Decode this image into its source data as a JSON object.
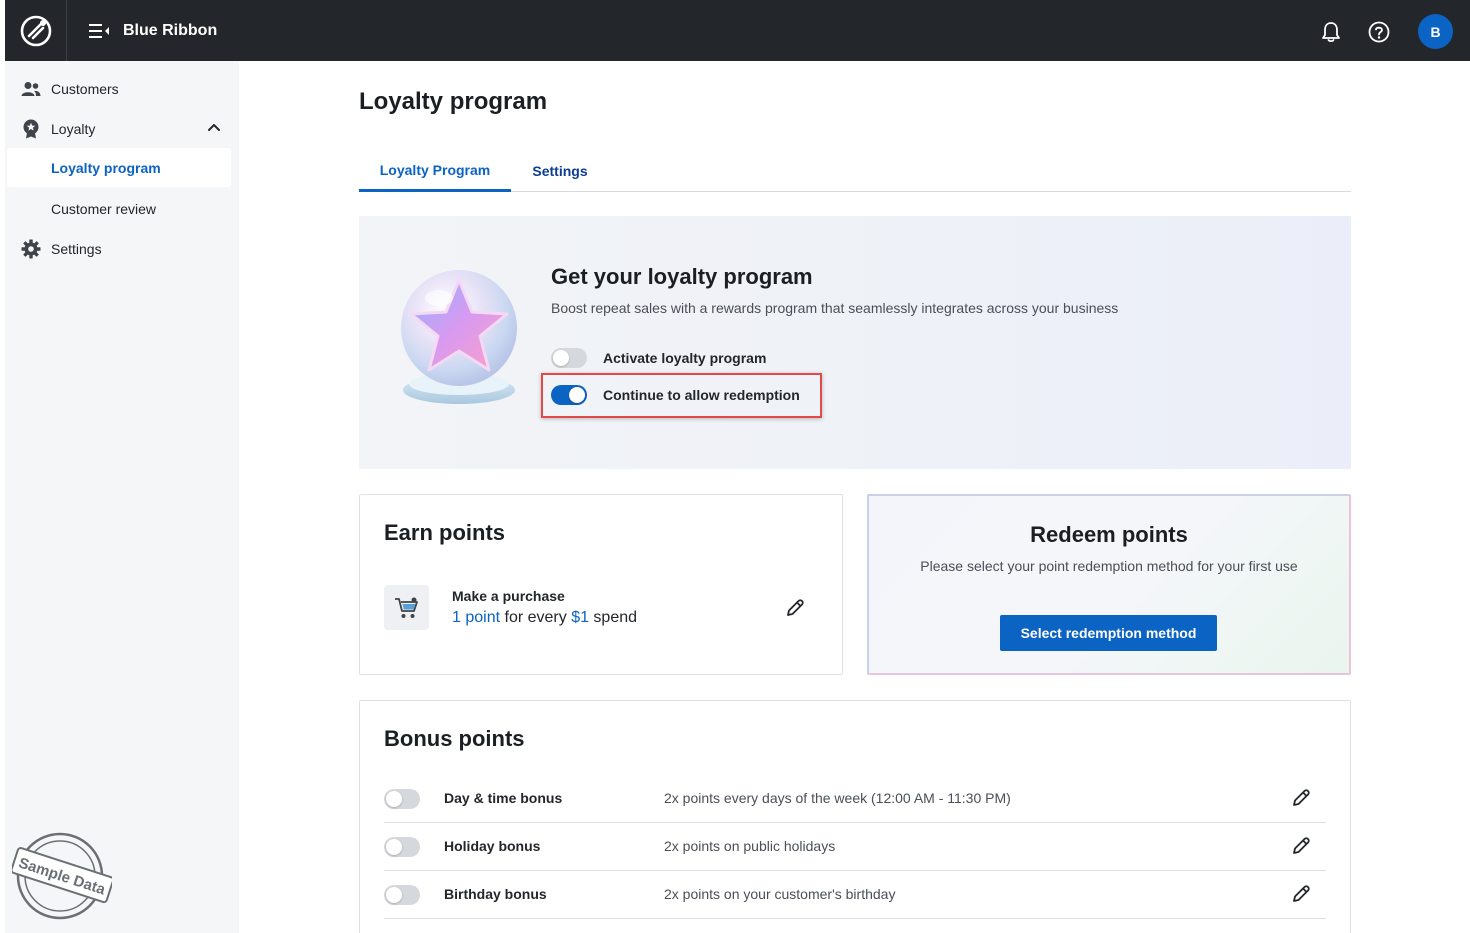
{
  "header": {
    "brand": "Blue Ribbon",
    "avatar_initial": "B",
    "icons": [
      "app-logo-icon",
      "menu-collapse-icon",
      "bell-icon",
      "help-icon"
    ]
  },
  "sidebar": {
    "items": [
      {
        "label": "Customers",
        "icon": "people-icon"
      },
      {
        "label": "Loyalty",
        "icon": "badge-icon",
        "expanded": true
      },
      {
        "label": "Loyalty program",
        "active": true
      },
      {
        "label": "Customer review"
      },
      {
        "label": "Settings",
        "icon": "gear-icon"
      }
    ],
    "stamp_text": "Sample Data"
  },
  "main": {
    "title": "Loyalty program",
    "tabs": [
      {
        "label": "Loyalty Program",
        "active": true
      },
      {
        "label": "Settings",
        "active": false
      }
    ],
    "hero": {
      "title": "Get your loyalty program",
      "subtitle": "Boost repeat sales with a rewards program that seamlessly integrates across your business",
      "toggles": [
        {
          "label": "Activate loyalty program",
          "on": false
        },
        {
          "label": "Continue to allow redemption",
          "on": true
        }
      ]
    },
    "earn": {
      "title": "Earn points",
      "row_title": "Make a purchase",
      "desc_points": "1 point",
      "desc_mid": " for every ",
      "desc_amount": "$1",
      "desc_end": " spend"
    },
    "redeem": {
      "title": "Redeem points",
      "subtitle": "Please select your point redemption method for your first use",
      "button": "Select redemption method"
    },
    "bonus": {
      "title": "Bonus points",
      "rows": [
        {
          "name": "Day & time bonus",
          "desc": "2x points every days of the week (12:00 AM - 11:30 PM)",
          "on": false
        },
        {
          "name": "Holiday bonus",
          "desc": "2x points on public holidays",
          "on": false
        },
        {
          "name": "Birthday bonus",
          "desc": "2x points on your customer's birthday",
          "on": false
        }
      ]
    }
  },
  "colors": {
    "topbar": "#23262b",
    "accent": "#0b63c4",
    "highlight_border": "#e24a4a"
  }
}
